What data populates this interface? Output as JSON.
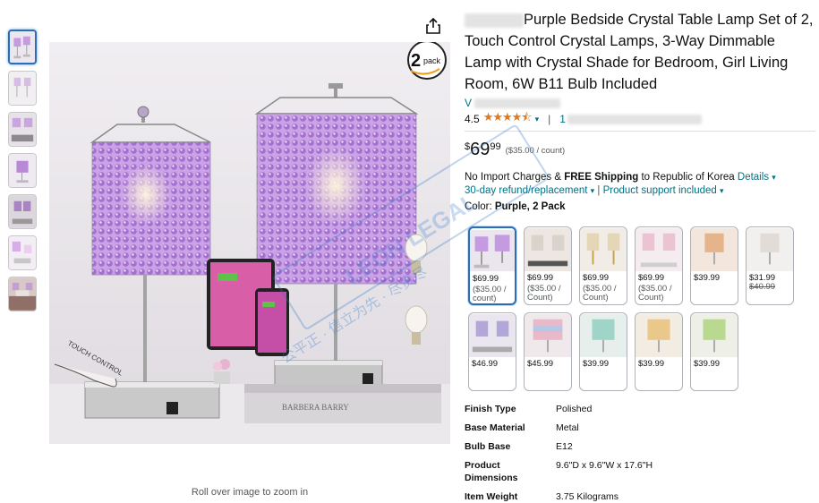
{
  "product": {
    "title": "Purple Bedside Crystal Table Lamp Set of 2, Touch Control Crystal Lamps, 3-Way Dimmable Lamp with Crystal Shade for Bedroom, Girl Living Room, 6W B11 Bulb Included",
    "brand_prefix": "V",
    "rating_value": "4.5",
    "rating_stars": 4.5,
    "ratings_count_prefix": "1",
    "price_symbol": "$",
    "price_whole": "69",
    "price_fraction": "99",
    "price_per_unit": "($35.00 / count)"
  },
  "shipping": {
    "prefix": "No Import Charges &",
    "free": "FREE Shipping",
    "dest": "to Republic of Korea",
    "details_link": "Details",
    "returns_link": "30-day refund/replacement",
    "separator": "|",
    "support_link": "Product support included"
  },
  "color": {
    "label": "Color:",
    "selected": "Purple, 2 Pack"
  },
  "swatches": [
    {
      "price": "$69.99",
      "unit": "($35.00 / count)",
      "selected": true
    },
    {
      "price": "$69.99",
      "unit": "($35.00 / Count)"
    },
    {
      "price": "$69.99",
      "unit": "($35.00 / Count)"
    },
    {
      "price": "$69.99",
      "unit": "($35.00 / Count)"
    },
    {
      "price": "$39.99",
      "unit": ""
    },
    {
      "price": "$31.99",
      "strike": "$40.99"
    },
    {
      "price": "$46.99"
    },
    {
      "price": "$45.99"
    },
    {
      "price": "$39.99"
    },
    {
      "price": "$39.99"
    },
    {
      "price": "$39.99"
    }
  ],
  "specs": [
    {
      "key": "Finish Type",
      "value": "Polished"
    },
    {
      "key": "Base Material",
      "value": "Metal"
    },
    {
      "key": "Bulb Base",
      "value": "E12"
    },
    {
      "key": "Product Dimensions",
      "value": "9.6\"D x 9.6\"W x 17.6\"H"
    },
    {
      "key": "Item Weight",
      "value": "3.75 Kilograms"
    }
  ],
  "image": {
    "badge_number": "2",
    "badge_text": "pack",
    "touch_label": "TOUCH CONTROL",
    "book_text": "BARBERA BARRY",
    "zoom_hint": "Roll over image to zoom in"
  },
  "watermark": {
    "cn_text": "公平正 · 信立为先 · 尽责尽",
    "en_text": "LEON LEGAL"
  },
  "colors": {
    "link": "#007185",
    "star": "#de7921",
    "selected_border": "#2c6db6",
    "lamp_purple": "#b98ad8"
  },
  "icons": [
    "share-icon",
    "star-icon",
    "chevron-down-icon"
  ]
}
